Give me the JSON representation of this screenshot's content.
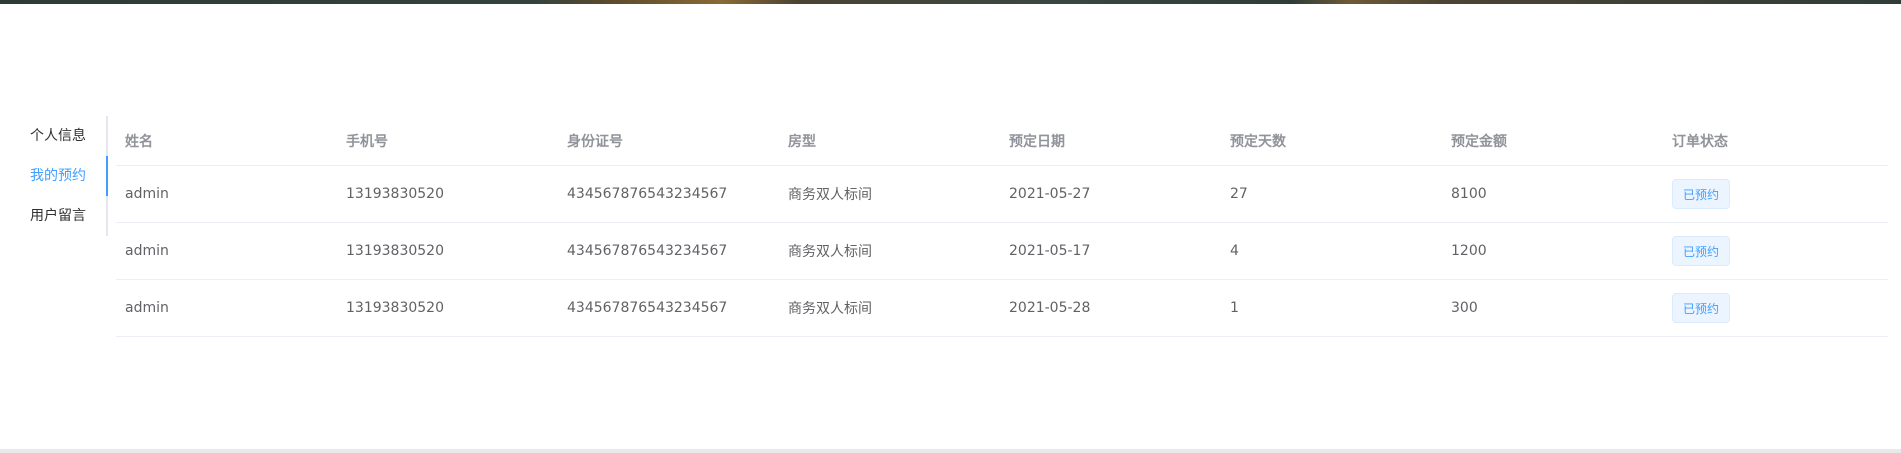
{
  "sidebar": {
    "tabs": [
      {
        "label": "个人信息"
      },
      {
        "label": "我的预约"
      },
      {
        "label": "用户留言"
      }
    ],
    "active_index": 1
  },
  "table": {
    "headers": [
      "姓名",
      "手机号",
      "身份证号",
      "房型",
      "预定日期",
      "预定天数",
      "预定金额",
      "订单状态"
    ],
    "rows": [
      [
        "admin",
        "13193830520",
        "434567876543234567",
        "商务双人标间",
        "2021-05-27",
        "27",
        "8100",
        "已预约"
      ],
      [
        "admin",
        "13193830520",
        "434567876543234567",
        "商务双人标间",
        "2021-05-17",
        "4",
        "1200",
        "已预约"
      ],
      [
        "admin",
        "13193830520",
        "434567876543234567",
        "商务双人标间",
        "2021-05-28",
        "1",
        "300",
        "已预约"
      ]
    ]
  },
  "colors": {
    "accent": "#409eff",
    "header_text": "#909399",
    "body_text": "#606266",
    "tag_bg": "#ecf5ff"
  }
}
